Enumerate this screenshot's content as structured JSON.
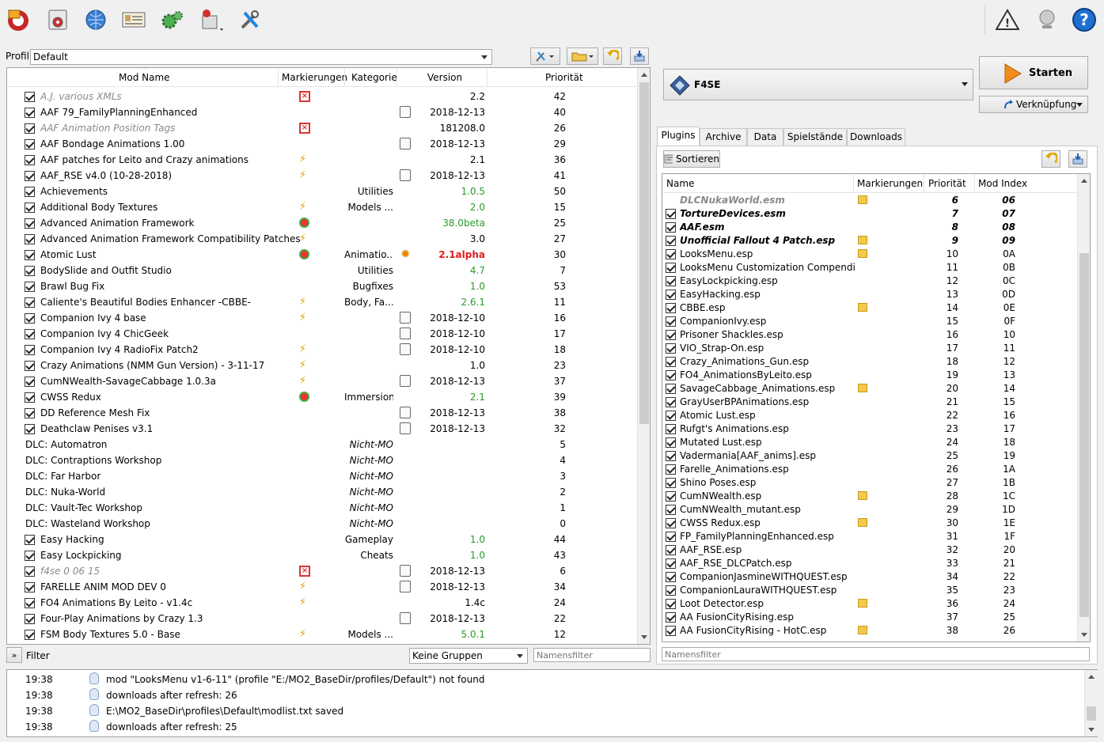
{
  "toolbar": {
    "icons": [
      "install-mod-icon",
      "nexus-icon",
      "globe-icon",
      "profiles-icon",
      "settings-gear-icon",
      "tools-icon",
      "wrench-screwdriver-icon"
    ],
    "right_icons": [
      "warning-icon",
      "network-icon",
      "help-icon"
    ],
    "help_label": "?",
    "warning_label": "!"
  },
  "profile": {
    "label": "Profil",
    "value": "Default"
  },
  "modlist": {
    "headers": {
      "name": "Mod Name",
      "flags": "Markierungen",
      "category": "Kategorie",
      "version": "Version",
      "priority": "Priorität"
    },
    "rows": [
      {
        "checked": true,
        "name": "A.J. various XMLs",
        "style": "italic-gray",
        "flag": "err",
        "cat": "",
        "ver": "2.2",
        "vclass": "",
        "prio": "42",
        "vicon": ""
      },
      {
        "checked": true,
        "name": "AAF 79_FamilyPlanningEnhanced",
        "style": "",
        "flag": "",
        "cat": "",
        "ver": "2018-12-13",
        "vclass": "",
        "prio": "40",
        "vicon": "date"
      },
      {
        "checked": true,
        "name": "AAF Animation Position Tags",
        "style": "italic-gray",
        "flag": "err",
        "cat": "",
        "ver": "181208.0",
        "vclass": "",
        "prio": "26",
        "vicon": ""
      },
      {
        "checked": true,
        "name": "AAF Bondage Animations 1.00",
        "style": "",
        "flag": "",
        "cat": "",
        "ver": "2018-12-13",
        "vclass": "",
        "prio": "29",
        "vicon": "date"
      },
      {
        "checked": true,
        "name": "AAF patches for Leito and Crazy animations",
        "style": "",
        "flag": "lightning",
        "cat": "",
        "ver": "2.1",
        "vclass": "",
        "prio": "36",
        "vicon": ""
      },
      {
        "checked": true,
        "name": "AAF_RSE v4.0 (10-28-2018)",
        "style": "",
        "flag": "lightning",
        "cat": "",
        "ver": "2018-12-13",
        "vclass": "",
        "prio": "41",
        "vicon": "date"
      },
      {
        "checked": true,
        "name": "Achievements",
        "style": "",
        "flag": "",
        "cat": "Utilities",
        "ver": "1.0.5",
        "vclass": "green",
        "prio": "50",
        "vicon": ""
      },
      {
        "checked": true,
        "name": "Additional Body Textures",
        "style": "",
        "flag": "lightning",
        "cat": "Models ...",
        "ver": "2.0",
        "vclass": "green",
        "prio": "15",
        "vicon": ""
      },
      {
        "checked": true,
        "name": "Advanced Animation Framework",
        "style": "",
        "flag": "heart",
        "cat": "",
        "ver": "38.0beta",
        "vclass": "green",
        "prio": "25",
        "vicon": ""
      },
      {
        "checked": true,
        "name": "Advanced Animation Framework Compatibility Patches",
        "style": "",
        "flag": "lightning",
        "cat": "",
        "ver": "3.0",
        "vclass": "",
        "prio": "27",
        "vicon": ""
      },
      {
        "checked": true,
        "name": "Atomic Lust",
        "style": "",
        "flag": "heart",
        "cat": "Animatio...",
        "ver": "2.1alpha",
        "vclass": "red",
        "prio": "30",
        "vicon": "sun"
      },
      {
        "checked": true,
        "name": "BodySlide and Outfit Studio",
        "style": "",
        "flag": "",
        "cat": "Utilities",
        "ver": "4.7",
        "vclass": "green",
        "prio": "7",
        "vicon": ""
      },
      {
        "checked": true,
        "name": "Brawl Bug Fix",
        "style": "",
        "flag": "",
        "cat": "Bugfixes",
        "ver": "1.0",
        "vclass": "green",
        "prio": "53",
        "vicon": ""
      },
      {
        "checked": true,
        "name": "Caliente's Beautiful Bodies Enhancer -CBBE-",
        "style": "",
        "flag": "lightning",
        "cat": "Body, Fa...",
        "ver": "2.6.1",
        "vclass": "green",
        "prio": "11",
        "vicon": ""
      },
      {
        "checked": true,
        "name": "Companion Ivy 4 base",
        "style": "",
        "flag": "lightning",
        "cat": "",
        "ver": "2018-12-10",
        "vclass": "",
        "prio": "16",
        "vicon": "date"
      },
      {
        "checked": true,
        "name": "Companion Ivy 4 ChicGeek",
        "style": "",
        "flag": "",
        "cat": "",
        "ver": "2018-12-10",
        "vclass": "",
        "prio": "17",
        "vicon": "date"
      },
      {
        "checked": true,
        "name": "Companion Ivy 4 RadioFix Patch2",
        "style": "",
        "flag": "lightning",
        "cat": "",
        "ver": "2018-12-10",
        "vclass": "",
        "prio": "18",
        "vicon": "date"
      },
      {
        "checked": true,
        "name": "Crazy Animations (NMM Gun Version) - 3-11-17",
        "style": "",
        "flag": "lightning",
        "cat": "",
        "ver": "1.0",
        "vclass": "",
        "prio": "23",
        "vicon": ""
      },
      {
        "checked": true,
        "name": "CumNWealth-SavageCabbage 1.0.3a",
        "style": "",
        "flag": "lightning",
        "cat": "",
        "ver": "2018-12-13",
        "vclass": "",
        "prio": "37",
        "vicon": "date"
      },
      {
        "checked": true,
        "name": "CWSS Redux",
        "style": "",
        "flag": "heart",
        "cat": "Immersion",
        "ver": "2.1",
        "vclass": "green",
        "prio": "39",
        "vicon": ""
      },
      {
        "checked": true,
        "name": "DD Reference Mesh Fix",
        "style": "",
        "flag": "",
        "cat": "",
        "ver": "2018-12-13",
        "vclass": "",
        "prio": "38",
        "vicon": "date"
      },
      {
        "checked": true,
        "name": "Deathclaw Penises v3.1",
        "style": "",
        "flag": "",
        "cat": "",
        "ver": "2018-12-13",
        "vclass": "",
        "prio": "32",
        "vicon": "date"
      },
      {
        "checked": false,
        "name": "DLC: Automatron",
        "style": "",
        "flag": "",
        "cat": "Nicht-MO",
        "ver": "",
        "vclass": "",
        "prio": "5",
        "vicon": ""
      },
      {
        "checked": false,
        "name": "DLC: Contraptions Workshop",
        "style": "",
        "flag": "",
        "cat": "Nicht-MO",
        "ver": "",
        "vclass": "",
        "prio": "4",
        "vicon": ""
      },
      {
        "checked": false,
        "name": "DLC: Far Harbor",
        "style": "",
        "flag": "",
        "cat": "Nicht-MO",
        "ver": "",
        "vclass": "",
        "prio": "3",
        "vicon": ""
      },
      {
        "checked": false,
        "name": "DLC: Nuka-World",
        "style": "",
        "flag": "",
        "cat": "Nicht-MO",
        "ver": "",
        "vclass": "",
        "prio": "2",
        "vicon": ""
      },
      {
        "checked": false,
        "name": "DLC: Vault-Tec Workshop",
        "style": "",
        "flag": "",
        "cat": "Nicht-MO",
        "ver": "",
        "vclass": "",
        "prio": "1",
        "vicon": ""
      },
      {
        "checked": false,
        "name": "DLC: Wasteland Workshop",
        "style": "",
        "flag": "",
        "cat": "Nicht-MO",
        "ver": "",
        "vclass": "",
        "prio": "0",
        "vicon": ""
      },
      {
        "checked": true,
        "name": "Easy Hacking",
        "style": "",
        "flag": "",
        "cat": "Gameplay",
        "ver": "1.0",
        "vclass": "green",
        "prio": "44",
        "vicon": ""
      },
      {
        "checked": true,
        "name": "Easy Lockpicking",
        "style": "",
        "flag": "",
        "cat": "Cheats",
        "ver": "1.0",
        "vclass": "green",
        "prio": "43",
        "vicon": ""
      },
      {
        "checked": true,
        "name": "f4se 0 06 15",
        "style": "italic-gray",
        "flag": "err",
        "cat": "",
        "ver": "2018-12-13",
        "vclass": "",
        "prio": "6",
        "vicon": "date"
      },
      {
        "checked": true,
        "name": "FARELLE ANIM MOD DEV 0",
        "style": "",
        "flag": "lightning",
        "cat": "",
        "ver": "2018-12-13",
        "vclass": "",
        "prio": "34",
        "vicon": "date"
      },
      {
        "checked": true,
        "name": "FO4 Animations By Leito - v1.4c",
        "style": "",
        "flag": "lightning",
        "cat": "",
        "ver": "1.4c",
        "vclass": "",
        "prio": "24",
        "vicon": ""
      },
      {
        "checked": true,
        "name": "Four-Play Animations by Crazy 1.3",
        "style": "",
        "flag": "",
        "cat": "",
        "ver": "2018-12-13",
        "vclass": "",
        "prio": "22",
        "vicon": "date"
      },
      {
        "checked": true,
        "name": "FSM Body Textures 5.0 - Base",
        "style": "",
        "flag": "lightning",
        "cat": "Models ...",
        "ver": "5.0.1",
        "vclass": "green",
        "prio": "12",
        "vicon": ""
      }
    ]
  },
  "filterbar": {
    "toggle": "»",
    "label": "Filter",
    "groups": "Keine Gruppen",
    "name_filter_placeholder": "Namensfilter"
  },
  "executable": {
    "name": "F4SE",
    "start": "Starten",
    "shortcut": "Verknüpfung"
  },
  "tabs": [
    "Plugins",
    "Archive",
    "Data",
    "Spielstände",
    "Downloads"
  ],
  "plugins": {
    "sort_label": "Sortieren",
    "headers": {
      "name": "Name",
      "flags": "Markierungen",
      "priority": "Priorität",
      "modindex": "Mod Index"
    },
    "rows": [
      {
        "cb": false,
        "name": "DLCNukaWorld.esm",
        "style": "italic-gray-bold",
        "box": true,
        "prio": "6",
        "mi": "06"
      },
      {
        "cb": true,
        "name": "TortureDevices.esm",
        "style": "italic-bold",
        "box": false,
        "prio": "7",
        "mi": "07"
      },
      {
        "cb": true,
        "name": "AAF.esm",
        "style": "italic-bold",
        "box": false,
        "prio": "8",
        "mi": "08"
      },
      {
        "cb": true,
        "name": "Unofficial Fallout 4 Patch.esp",
        "style": "italic-bold",
        "box": true,
        "prio": "9",
        "mi": "09"
      },
      {
        "cb": true,
        "name": "LooksMenu.esp",
        "style": "",
        "box": true,
        "prio": "10",
        "mi": "0A"
      },
      {
        "cb": true,
        "name": "LooksMenu Customization Compendi...",
        "style": "",
        "box": false,
        "prio": "11",
        "mi": "0B"
      },
      {
        "cb": true,
        "name": "EasyLockpicking.esp",
        "style": "",
        "box": false,
        "prio": "12",
        "mi": "0C"
      },
      {
        "cb": true,
        "name": "EasyHacking.esp",
        "style": "",
        "box": false,
        "prio": "13",
        "mi": "0D"
      },
      {
        "cb": true,
        "name": "CBBE.esp",
        "style": "",
        "box": true,
        "prio": "14",
        "mi": "0E"
      },
      {
        "cb": true,
        "name": "CompanionIvy.esp",
        "style": "",
        "box": false,
        "prio": "15",
        "mi": "0F"
      },
      {
        "cb": true,
        "name": "Prisoner Shackles.esp",
        "style": "",
        "box": false,
        "prio": "16",
        "mi": "10"
      },
      {
        "cb": true,
        "name": "VIO_Strap-On.esp",
        "style": "",
        "box": false,
        "prio": "17",
        "mi": "11"
      },
      {
        "cb": true,
        "name": "Crazy_Animations_Gun.esp",
        "style": "",
        "box": false,
        "prio": "18",
        "mi": "12"
      },
      {
        "cb": true,
        "name": "FO4_AnimationsByLeito.esp",
        "style": "",
        "box": false,
        "prio": "19",
        "mi": "13"
      },
      {
        "cb": true,
        "name": "SavageCabbage_Animations.esp",
        "style": "",
        "box": true,
        "prio": "20",
        "mi": "14"
      },
      {
        "cb": true,
        "name": "GrayUserBPAnimations.esp",
        "style": "",
        "box": false,
        "prio": "21",
        "mi": "15"
      },
      {
        "cb": true,
        "name": "Atomic Lust.esp",
        "style": "",
        "box": false,
        "prio": "22",
        "mi": "16"
      },
      {
        "cb": true,
        "name": "Rufgt's Animations.esp",
        "style": "",
        "box": false,
        "prio": "23",
        "mi": "17"
      },
      {
        "cb": true,
        "name": "Mutated Lust.esp",
        "style": "",
        "box": false,
        "prio": "24",
        "mi": "18"
      },
      {
        "cb": true,
        "name": "Vadermania[AAF_anims].esp",
        "style": "",
        "box": false,
        "prio": "25",
        "mi": "19"
      },
      {
        "cb": true,
        "name": "Farelle_Animations.esp",
        "style": "",
        "box": false,
        "prio": "26",
        "mi": "1A"
      },
      {
        "cb": true,
        "name": "Shino Poses.esp",
        "style": "",
        "box": false,
        "prio": "27",
        "mi": "1B"
      },
      {
        "cb": true,
        "name": "CumNWealth.esp",
        "style": "",
        "box": true,
        "prio": "28",
        "mi": "1C"
      },
      {
        "cb": true,
        "name": "CumNWealth_mutant.esp",
        "style": "",
        "box": false,
        "prio": "29",
        "mi": "1D"
      },
      {
        "cb": true,
        "name": "CWSS Redux.esp",
        "style": "",
        "box": true,
        "prio": "30",
        "mi": "1E"
      },
      {
        "cb": true,
        "name": "FP_FamilyPlanningEnhanced.esp",
        "style": "",
        "box": false,
        "prio": "31",
        "mi": "1F"
      },
      {
        "cb": true,
        "name": "AAF_RSE.esp",
        "style": "",
        "box": false,
        "prio": "32",
        "mi": "20"
      },
      {
        "cb": true,
        "name": "AAF_RSE_DLCPatch.esp",
        "style": "",
        "box": false,
        "prio": "33",
        "mi": "21"
      },
      {
        "cb": true,
        "name": "CompanionJasmineWITHQUEST.esp",
        "style": "",
        "box": false,
        "prio": "34",
        "mi": "22"
      },
      {
        "cb": true,
        "name": "CompanionLauraWITHQUEST.esp",
        "style": "",
        "box": false,
        "prio": "35",
        "mi": "23"
      },
      {
        "cb": true,
        "name": "Loot Detector.esp",
        "style": "",
        "box": true,
        "prio": "36",
        "mi": "24"
      },
      {
        "cb": true,
        "name": "AA FusionCityRising.esp",
        "style": "",
        "box": false,
        "prio": "37",
        "mi": "25"
      },
      {
        "cb": true,
        "name": "AA FusionCityRising - HotC.esp",
        "style": "",
        "box": true,
        "prio": "38",
        "mi": "26"
      }
    ],
    "name_filter_placeholder": "Namensfilter"
  },
  "log": [
    {
      "time": "19:38",
      "msg": "mod \"LooksMenu v1-6-11\" (profile \"E:/MO2_BaseDir/profiles/Default\") not found"
    },
    {
      "time": "19:38",
      "msg": "downloads after refresh: 26"
    },
    {
      "time": "19:38",
      "msg": "E:\\MO2_BaseDir\\profiles\\Default\\modlist.txt saved"
    },
    {
      "time": "19:38",
      "msg": "downloads after refresh: 25"
    }
  ]
}
